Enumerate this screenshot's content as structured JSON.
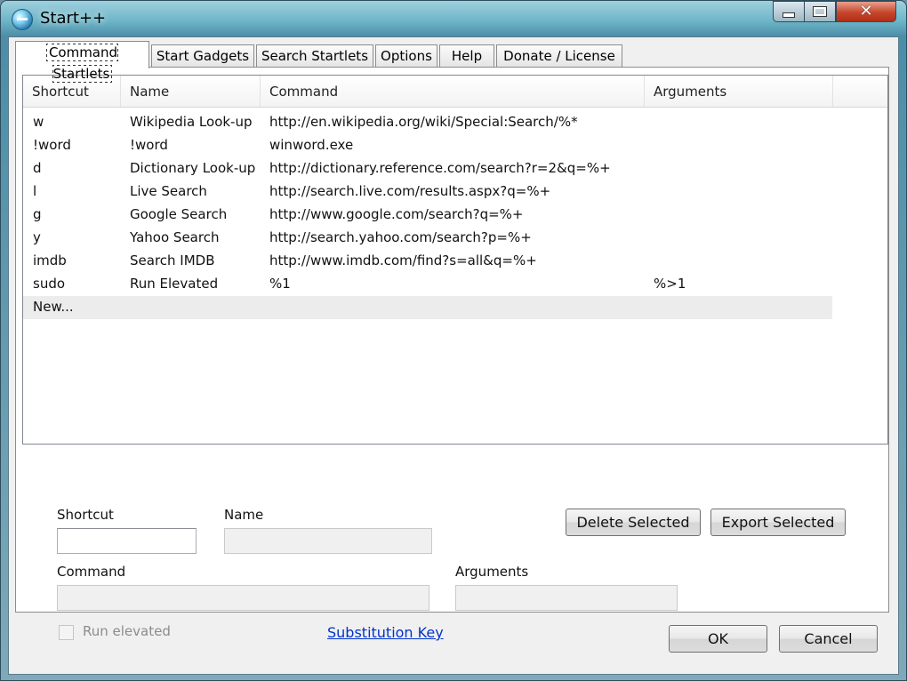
{
  "window": {
    "title": "Start++"
  },
  "tabs": [
    {
      "label": "Command Startlets"
    },
    {
      "label": "Start Gadgets"
    },
    {
      "label": "Search Startlets"
    },
    {
      "label": "Options"
    },
    {
      "label": "Help"
    },
    {
      "label": "Donate / License"
    }
  ],
  "list": {
    "columns": [
      "Shortcut",
      "Name",
      "Command",
      "Arguments"
    ],
    "rows": [
      [
        "w",
        "Wikipedia Look-up",
        "http://en.wikipedia.org/wiki/Special:Search/%*",
        ""
      ],
      [
        "!word",
        "!word",
        "winword.exe",
        ""
      ],
      [
        "d",
        "Dictionary Look-up",
        "http://dictionary.reference.com/search?r=2&q=%+",
        ""
      ],
      [
        "l",
        "Live Search",
        "http://search.live.com/results.aspx?q=%+",
        ""
      ],
      [
        "g",
        "Google Search",
        "http://www.google.com/search?q=%+",
        ""
      ],
      [
        "y",
        "Yahoo Search",
        "http://search.yahoo.com/search?p=%+",
        ""
      ],
      [
        "imdb",
        "Search IMDB",
        "http://www.imdb.com/find?s=all&q=%+",
        ""
      ],
      [
        "sudo",
        "Run Elevated",
        "%1",
        "%>1"
      ]
    ],
    "new_row_label": "New..."
  },
  "form": {
    "shortcut_label": "Shortcut",
    "shortcut_value": "",
    "name_label": "Name",
    "name_value": "",
    "command_label": "Command",
    "command_value": "",
    "arguments_label": "Arguments",
    "arguments_value": "",
    "run_elevated_label": "Run elevated",
    "run_elevated_checked": false,
    "substitution_key_label": "Substitution Key",
    "delete_selected_label": "Delete Selected",
    "export_selected_label": "Export Selected"
  },
  "footer": {
    "ok_label": "OK",
    "cancel_label": "Cancel"
  },
  "colors": {
    "link": "#0033cc",
    "close_button": "#c6462c",
    "window_frame": "#6fb6c9"
  },
  "icons": {
    "app": "start-orb-icon",
    "minimize": "minimize-icon",
    "maximize": "maximize-icon",
    "close": "close-icon"
  }
}
